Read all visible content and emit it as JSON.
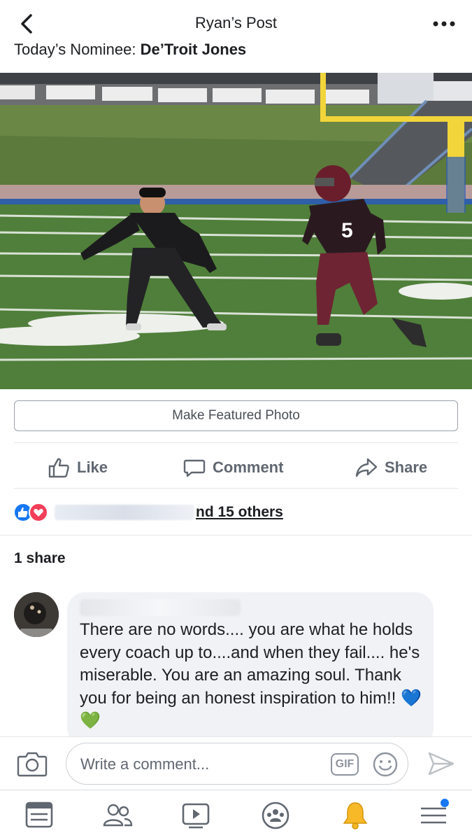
{
  "header": {
    "title": "Ryan’s Post"
  },
  "post": {
    "caption_prefix": "Today’s Nominee: ",
    "caption_name": "De’Troit Jones",
    "featured_button": "Make Featured Photo"
  },
  "actions": {
    "like": "Like",
    "comment": "Comment",
    "share": "Share"
  },
  "reactions": {
    "others_text": "nd 15 others"
  },
  "shares": {
    "text": "1 share"
  },
  "comment": {
    "text": "There are no words.... you are what he holds every coach up to....and when they fail.... he's miserable. You are an amazing soul. Thank you for being an honest inspiration to him!! 💙💚"
  },
  "composer": {
    "placeholder": "Write a comment...",
    "gif_label": "GIF"
  },
  "colors": {
    "brand_blue": "#1877f2",
    "love_red": "#f33e58",
    "field_green": "#4f7f3a"
  },
  "icons": [
    "back-chevron-icon",
    "more-icon",
    "like-icon",
    "comment-icon",
    "share-icon",
    "camera-icon",
    "emoji-icon",
    "send-icon",
    "news-feed-icon",
    "friends-icon",
    "watch-icon",
    "groups-icon",
    "notifications-icon",
    "menu-icon"
  ]
}
